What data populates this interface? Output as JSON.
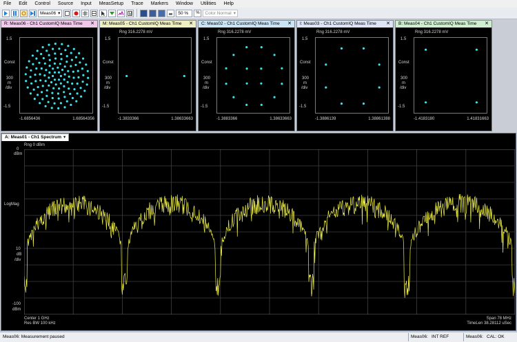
{
  "menu": [
    "File",
    "Edit",
    "Control",
    "Source",
    "Input",
    "MeasSetup",
    "Trace",
    "Markers",
    "Window",
    "Utilities",
    "Help"
  ],
  "toolbar": {
    "meas_select": "Meas06",
    "zoom": "50 %",
    "color_mode": "Color Normal"
  },
  "const_panels": [
    {
      "tab": "R: Meas06 - Ch1 CustomIQ Meas Time",
      "tab_color": "#f0c8ea",
      "range": "",
      "top": "1.5",
      "mid1": "Const",
      "mid2": "300",
      "mid3": "m",
      "mid4": "/div",
      "bottom": "-1.5",
      "xmin": "-1.6856436",
      "xmax": "1.68564356",
      "points": "qam64"
    },
    {
      "tab": "M: Meas05 - Ch1 CustomIQ Meas Time",
      "tab_color": "#eef0c4",
      "range": "Rng 316.2278 mV",
      "top": "1.5",
      "mid1": "Const",
      "mid2": "300",
      "mid3": "m",
      "mid4": "/div",
      "bottom": "-1.5",
      "xmin": "-1.3833366",
      "xmax": "1.38633663",
      "points": "bpsk"
    },
    {
      "tab": "C: Meas02 - Ch1 CustomIQ Meas Time",
      "tab_color": "#c8e4f5",
      "range": "Rng 316.2278 mV",
      "top": "1.5",
      "mid1": "Const",
      "mid2": "300",
      "mid3": "m",
      "mid4": "/div",
      "bottom": "-1.5",
      "xmin": "-1.3883366",
      "xmax": "1.38633663",
      "points": "apsk16"
    },
    {
      "tab": "I: Meas03 - Ch1 CustomIQ Meas Time",
      "tab_color": "#dde4f5",
      "range": "Rng 316.2278 mV",
      "top": "1.5",
      "mid1": "Const",
      "mid2": "300",
      "mid3": "m",
      "mid4": "/div",
      "bottom": "-1.5",
      "xmin": "-1.3886139",
      "xmax": "1.38861388",
      "points": "psk8"
    },
    {
      "tab": "B: Meas04 - Ch1 CustomIQ Meas Time",
      "tab_color": "#cfeed0",
      "range": "Rng 316.2278 mV",
      "top": "1.5",
      "mid1": "Const",
      "mid2": "300",
      "mid3": "m",
      "mid4": "/div",
      "bottom": "-1.5",
      "xmin": "-1.4183180",
      "xmax": "1.41831663",
      "points": "qpsk"
    }
  ],
  "spectrum": {
    "tab": "A: Meas01 - Ch1 Spectrum",
    "range": "Rng 0 dBm",
    "y_top_val": "0",
    "y_top_unit": "dBm",
    "y_mid": "LogMag",
    "y_div_val": "10",
    "y_div_unit": "dB",
    "y_div_label": "/div",
    "y_bottom": "-100",
    "y_bottom_unit": "dBm",
    "center": "Center 1 GHz",
    "res_bw": "Res BW 100 kHz",
    "span": "Span 78 MHz",
    "timelen": "TimeLen 38.28112 uSec",
    "trace_color": "#f0f04a"
  },
  "status": {
    "left": "Meas06:   Measurement paused",
    "meas1": "Meas06:",
    "int_ref": "INT REF",
    "meas2": "Meas06:",
    "cal": "CAL: OK"
  }
}
